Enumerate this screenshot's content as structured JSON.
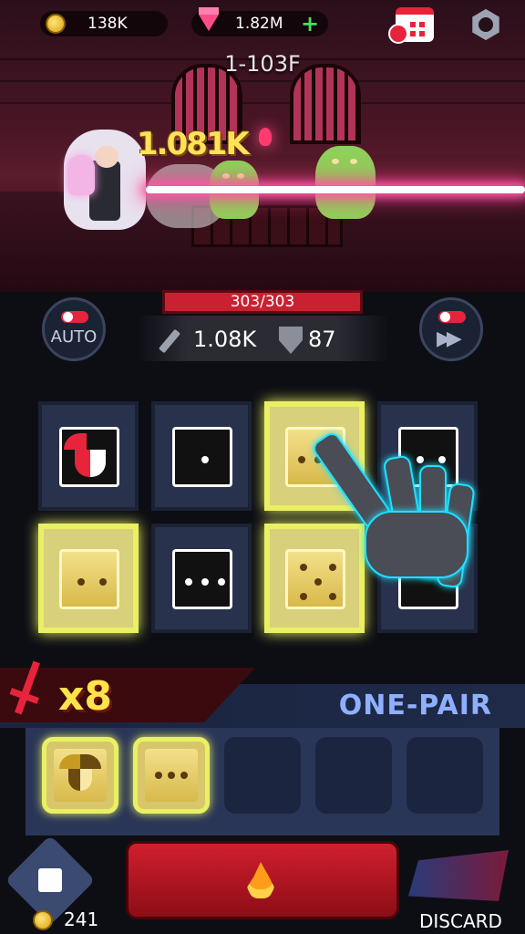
{
  "hud": {
    "gold": "138K",
    "gems": "1.82M",
    "add_gems_symbol": "+"
  },
  "stage": {
    "floor": "1-103F",
    "damage_popup": "1.081K"
  },
  "player": {
    "hp_text": "303/303",
    "attack": "1.08K",
    "defense": "87"
  },
  "controls": {
    "auto_label": "AUTO",
    "fast_forward_symbol": "▶▶"
  },
  "board": {
    "rows": [
      [
        {
          "kind": "joker",
          "selected": false
        },
        {
          "kind": "die",
          "pips": 1,
          "selected": false
        },
        {
          "kind": "die",
          "pips": 3,
          "selected": true
        },
        {
          "kind": "die",
          "pips": 2,
          "selected": false
        }
      ],
      [
        {
          "kind": "die",
          "pips": 2,
          "selected": true
        },
        {
          "kind": "die",
          "pips": 3,
          "selected": false
        },
        {
          "kind": "die",
          "pips": 5,
          "selected": true
        },
        {
          "kind": "die",
          "pips": 0,
          "selected": false
        }
      ]
    ]
  },
  "combo": {
    "multiplier": "x8",
    "hand_name": "ONE-PAIR",
    "slots": [
      {
        "kind": "joker",
        "filled": true
      },
      {
        "kind": "die",
        "pips": 3,
        "filled": true
      },
      {
        "kind": "empty",
        "filled": false
      },
      {
        "kind": "empty",
        "filled": false
      },
      {
        "kind": "empty",
        "filled": false
      }
    ]
  },
  "actions": {
    "reroll_cost": "241",
    "discard_label": "DISCARD"
  },
  "colors": {
    "accent_red": "#e8243c",
    "selected_glow": "#e9f063",
    "hand_name": "#8fb0ff",
    "multiplier": "#ffe34a"
  }
}
